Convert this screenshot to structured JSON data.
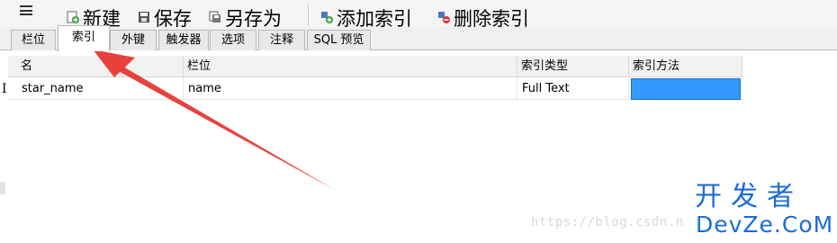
{
  "toolbar": {
    "buttons": [
      {
        "label": "新建",
        "icon": "new-icon"
      },
      {
        "label": "保存",
        "icon": "save-icon"
      },
      {
        "label": "另存为",
        "icon": "save-as-icon"
      },
      {
        "label": "添加索引",
        "icon": "add-index-icon"
      },
      {
        "label": "删除索引",
        "icon": "delete-index-icon"
      }
    ]
  },
  "tabs": [
    {
      "label": "栏位"
    },
    {
      "label": "索引",
      "active": true
    },
    {
      "label": "外键"
    },
    {
      "label": "触发器"
    },
    {
      "label": "选项"
    },
    {
      "label": "注释"
    },
    {
      "label": "SQL 预览"
    }
  ],
  "grid": {
    "columns": [
      "名",
      "栏位",
      "索引类型",
      "索引方法"
    ],
    "rows": [
      {
        "marker": "I",
        "name": "star_name",
        "field": "name",
        "type": "Full Text",
        "method": ""
      }
    ]
  },
  "watermark": {
    "url": "https://blog.csdn.n",
    "brand_cn": "开发者",
    "brand_en": "DevZe.CoM"
  },
  "colors": {
    "selection": "#3399ff",
    "arrow": "#e8413c",
    "watermark": "#1d6bd6"
  }
}
